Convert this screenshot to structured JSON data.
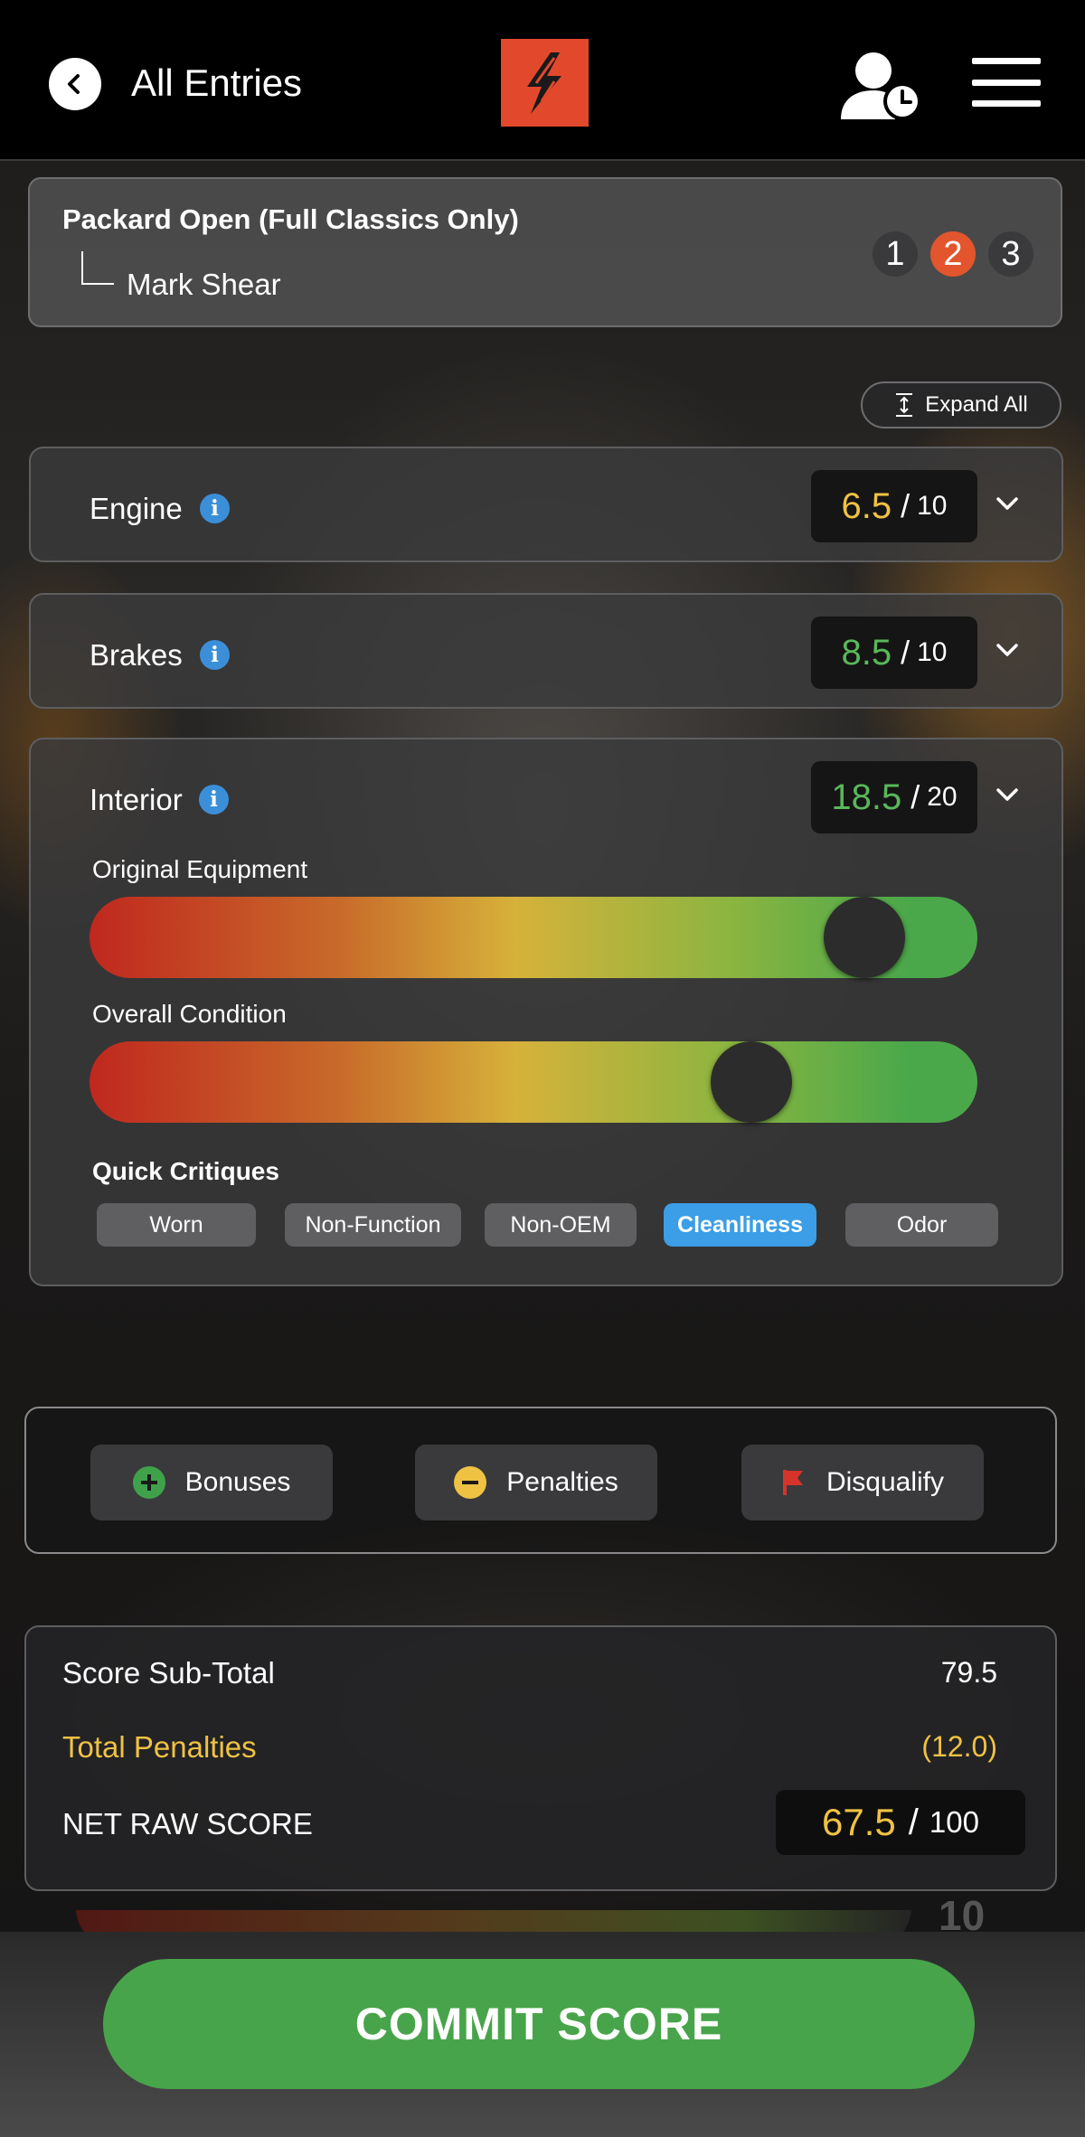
{
  "header": {
    "back_label": "All Entries",
    "icons": [
      "back-icon",
      "logo",
      "user-clock-icon",
      "menu-icon"
    ],
    "logo_color": "#e2482c"
  },
  "entry": {
    "class_title": "Packard Open (Full Classics Only)",
    "judge_name": "Mark Shear",
    "steps": [
      "1",
      "2",
      "3"
    ],
    "active_step": "2"
  },
  "expand_all_label": "Expand All",
  "categories": [
    {
      "name": "Engine",
      "score": "6.5",
      "max": "10",
      "score_color": "#f0c243",
      "expanded": false
    },
    {
      "name": "Brakes",
      "score": "8.5",
      "max": "10",
      "score_color": "#59b85a",
      "expanded": false
    },
    {
      "name": "Interior",
      "score": "18.5",
      "max": "20",
      "score_color": "#59b85a",
      "expanded": true,
      "sliders": [
        {
          "label": "Original Equipment",
          "level": 0.91
        },
        {
          "label": "Overall Condition",
          "level": 0.77
        }
      ],
      "quick_critiques_title": "Quick Critiques",
      "critiques": [
        {
          "label": "Worn",
          "selected": false
        },
        {
          "label": "Non-Function",
          "selected": false
        },
        {
          "label": "Non-OEM",
          "selected": false
        },
        {
          "label": "Cleanliness",
          "selected": true
        },
        {
          "label": "Odor",
          "selected": false
        }
      ]
    }
  ],
  "actions": {
    "bonuses": "Bonuses",
    "penalties": "Penalties",
    "disqualify": "Disqualify"
  },
  "totals": {
    "subtotal_label": "Score Sub-Total",
    "subtotal_value": "79.5",
    "penalties_label": "Total Penalties",
    "penalties_value": "(12.0)",
    "net_label": "NET RAW SCORE",
    "net_value": "67.5",
    "net_max": "100"
  },
  "peek_number": "10",
  "commit_label": "COMMIT SCORE",
  "colors": {
    "accent_orange": "#e2552d",
    "green": "#48a44a",
    "yellow": "#f0c243",
    "blue": "#3b9ee6"
  }
}
